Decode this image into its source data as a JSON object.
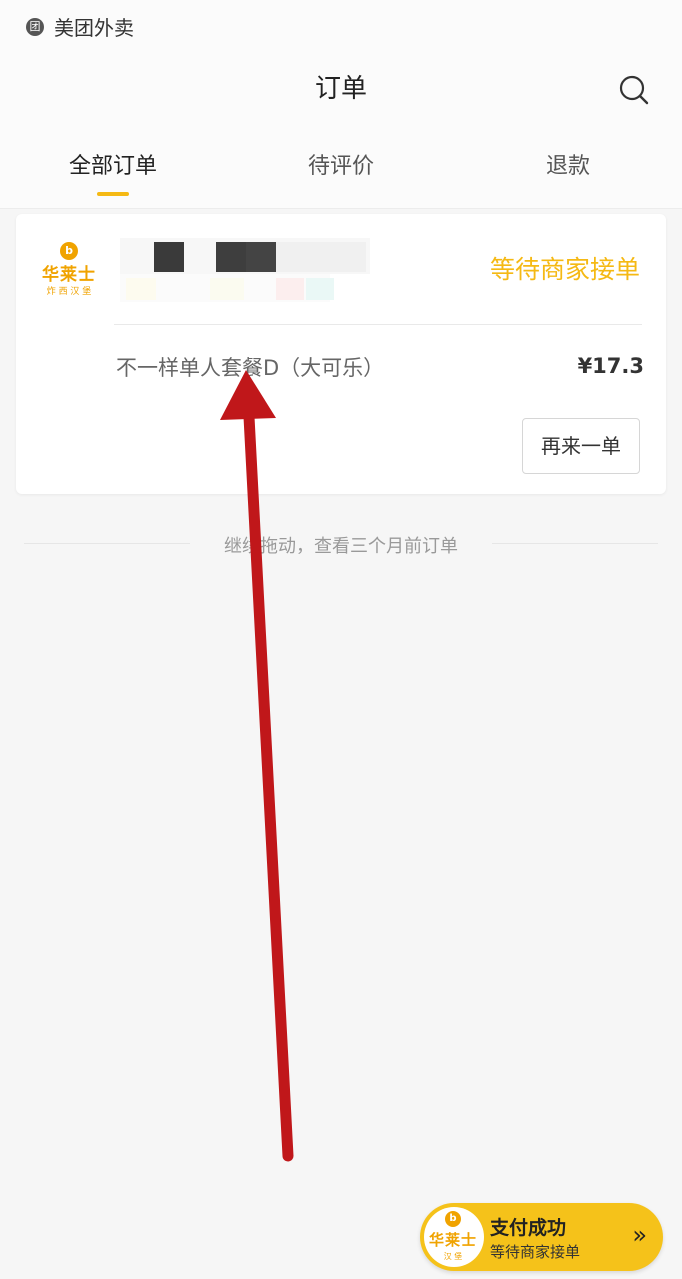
{
  "app": {
    "name": "美团外卖",
    "icon": "团"
  },
  "header": {
    "title": "订单",
    "search_icon": "search-icon"
  },
  "tabs": [
    {
      "label": "全部订单",
      "active": true
    },
    {
      "label": "待评价",
      "active": false
    },
    {
      "label": "退款",
      "active": false
    }
  ],
  "order": {
    "shop_logo": {
      "main": "华莱士",
      "sub": "炸 西 汉 堡",
      "symbol": "b"
    },
    "status": "等待商家接单",
    "item": "不一样单人套餐D（大可乐）",
    "price": "¥17.3",
    "reorder_label": "再来一单"
  },
  "older_orders_hint": "继续拖动，查看三个月前订单",
  "payment_toast": {
    "logo_main": "华莱士",
    "logo_sub": "汉 堡",
    "logo_symbol": "b",
    "title": "支付成功",
    "subtitle": "等待商家接单",
    "chevron": "»"
  },
  "colors": {
    "accent": "#f5b914",
    "annotation_arrow": "#c0171a"
  }
}
